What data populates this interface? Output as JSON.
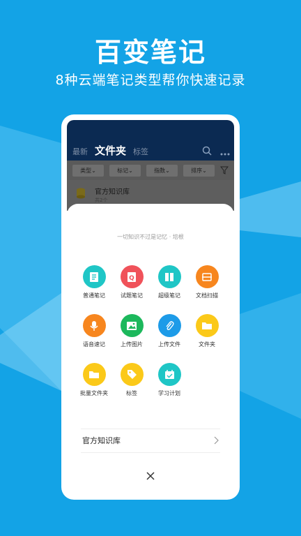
{
  "promo": {
    "title": "百变笔记",
    "subtitle": "8种云端笔记类型帮你快速记录"
  },
  "app": {
    "tabs": [
      {
        "label": "最新"
      },
      {
        "label": "文件夹"
      },
      {
        "label": "标签"
      }
    ],
    "filters": [
      {
        "label": "类型"
      },
      {
        "label": "标记"
      },
      {
        "label": "指数"
      },
      {
        "label": "排序"
      }
    ],
    "knowledge_base": {
      "title": "官方知识库",
      "subtitle": "共2个"
    }
  },
  "sheet": {
    "quote": "一切知识不过是记忆 · 培根",
    "items": [
      {
        "label": "普通笔记",
        "icon": "note-icon",
        "color": "#1fc6c6"
      },
      {
        "label": "试题笔记",
        "icon": "question-icon",
        "color": "#f0525a"
      },
      {
        "label": "超级笔记",
        "icon": "book-icon",
        "color": "#1fc6c6"
      },
      {
        "label": "文档扫描",
        "icon": "scan-icon",
        "color": "#f7861e"
      },
      {
        "label": "语音速记",
        "icon": "microphone-icon",
        "color": "#f7861e"
      },
      {
        "label": "上传图片",
        "icon": "image-icon",
        "color": "#1cb85c"
      },
      {
        "label": "上传文件",
        "icon": "paperclip-icon",
        "color": "#1d9be8"
      },
      {
        "label": "文件夹",
        "icon": "folder-icon",
        "color": "#fbc919"
      },
      {
        "label": "批量文件夹",
        "icon": "folder-batch-icon",
        "color": "#fbc919"
      },
      {
        "label": "标签",
        "icon": "tag-icon",
        "color": "#fbc919"
      },
      {
        "label": "学习计划",
        "icon": "calendar-icon",
        "color": "#1fc6c6"
      }
    ],
    "link_label": "官方知识库"
  },
  "colors": {
    "background": "#13a3e6",
    "app_header": "#0b2a52"
  }
}
